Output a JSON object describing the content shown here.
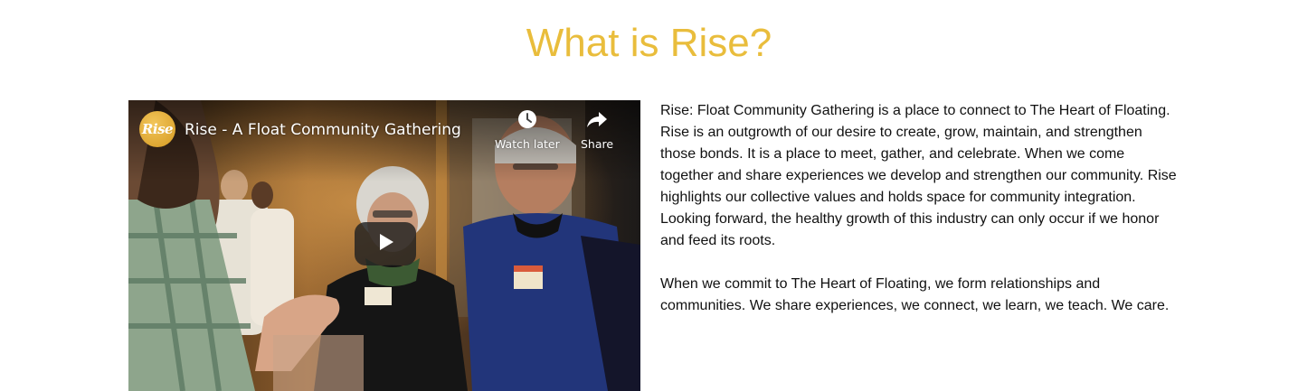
{
  "section": {
    "title": "What is Rise?"
  },
  "video": {
    "title": "Rise - A Float Community Gathering",
    "channel_logo_text": "Rise",
    "watch_later_label": "Watch later",
    "share_label": "Share",
    "icons": {
      "watch_later": "clock-icon",
      "share": "share-arrow-icon",
      "play": "play-icon"
    }
  },
  "description": {
    "paragraphs": [
      "Rise: Float Community Gathering is a place to connect to The Heart of Floating. Rise is an outgrowth of our desire to create, grow, maintain, and strengthen those bonds. It is a place to meet, gather, and celebrate. When we come together and share experiences we develop and strengthen our community. Rise highlights our collective values and holds space for community integration. Looking forward, the healthy growth of this industry can only occur if we honor and feed its roots.",
      "When we commit to The Heart of Floating, we form relationships and communities. We share experiences, we connect, we learn, we teach. We care."
    ]
  },
  "colors": {
    "title": "#e9bd3c",
    "text": "#111111",
    "logo": "#e2a93a"
  }
}
